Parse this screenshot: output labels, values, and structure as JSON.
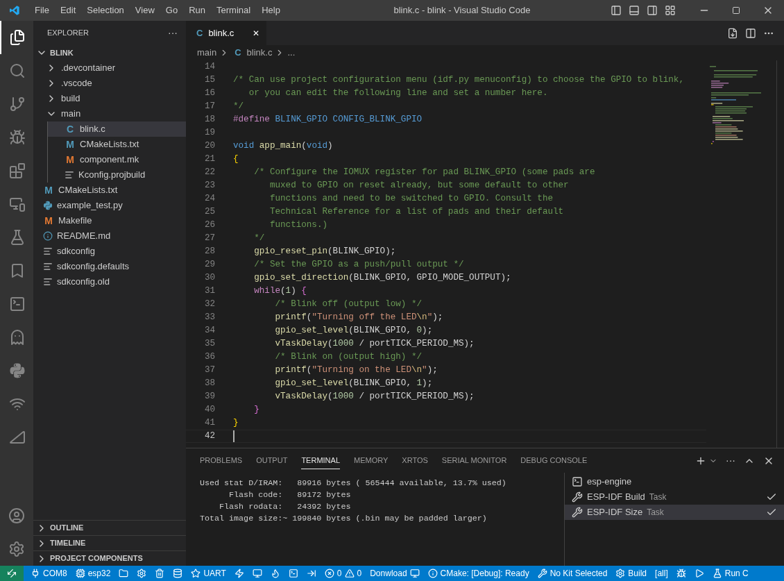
{
  "title_bar": {
    "menu": [
      "File",
      "Edit",
      "Selection",
      "View",
      "Go",
      "Run",
      "Terminal",
      "Help"
    ],
    "title": "blink.c - blink - Visual Studio Code"
  },
  "activity_bar": [
    {
      "selected": true
    },
    {
      "selected": false
    },
    {
      "selected": false
    },
    {
      "selected": false
    },
    {
      "selected": false
    },
    {
      "selected": false
    },
    {
      "selected": false
    },
    {
      "selected": false
    },
    {
      "selected": false
    },
    {
      "selected": false
    },
    {
      "selected": false
    },
    {
      "selected": false
    },
    {
      "selected": false
    }
  ],
  "sidebar": {
    "title": "EXPLORER",
    "more": "···",
    "folder": "BLINK",
    "items": [
      {
        "label": ".devcontainer",
        "kind": "folder",
        "expanded": false,
        "selected": false
      },
      {
        "label": ".vscode",
        "kind": "folder",
        "expanded": false,
        "selected": false
      },
      {
        "label": "build",
        "kind": "folder",
        "expanded": false,
        "selected": false
      },
      {
        "label": "main",
        "kind": "folder",
        "expanded": true,
        "selected": false,
        "children": [
          {
            "label": "blink.c",
            "kind": "c",
            "icon": "C",
            "selected": true
          },
          {
            "label": "CMakeLists.txt",
            "kind": "cmake",
            "icon": "M",
            "selected": false
          },
          {
            "label": "component.mk",
            "kind": "make",
            "icon": "M",
            "selected": false
          },
          {
            "label": "Kconfig.projbuild",
            "kind": "text",
            "selected": false
          }
        ]
      },
      {
        "label": "CMakeLists.txt",
        "kind": "cmake",
        "icon": "M",
        "selected": false
      },
      {
        "label": "example_test.py",
        "kind": "python",
        "selected": false
      },
      {
        "label": "Makefile",
        "kind": "make",
        "icon": "M",
        "selected": false
      },
      {
        "label": "README.md",
        "kind": "info",
        "selected": false
      },
      {
        "label": "sdkconfig",
        "kind": "text",
        "selected": false
      },
      {
        "label": "sdkconfig.defaults",
        "kind": "text",
        "selected": false
      },
      {
        "label": "sdkconfig.old",
        "kind": "text",
        "selected": false
      }
    ],
    "sections": [
      "OUTLINE",
      "TIMELINE",
      "PROJECT COMPONENTS"
    ]
  },
  "editor": {
    "tab": {
      "icon": "C",
      "label": "blink.c",
      "close": "✕"
    },
    "breadcrumbs": [
      "main",
      "blink.c",
      "..."
    ],
    "breadcrumb_icon": "C",
    "lines": [
      {
        "number": "14",
        "current": false
      },
      {
        "number": "15",
        "current": false,
        "tokens": [
          {
            "kind": "comment",
            "text": "/* Can use project configuration menu (idf.py menuconfig) to choose the GPIO to blink,"
          }
        ]
      },
      {
        "number": "16",
        "current": false,
        "tokens": [
          {
            "kind": "comment",
            "text": "   or you can edit the following line and set a number here."
          }
        ]
      },
      {
        "number": "17",
        "current": false,
        "tokens": [
          {
            "kind": "comment",
            "text": "*/"
          }
        ]
      },
      {
        "number": "18",
        "current": false,
        "tokens": [
          {
            "kind": "control",
            "text": "#define "
          },
          {
            "kind": "keyword",
            "text": "BLINK_GPIO CONFIG_BLINK_GPIO"
          }
        ]
      },
      {
        "number": "19",
        "current": false
      },
      {
        "number": "20",
        "current": false,
        "tokens": [
          {
            "kind": "keyword",
            "text": "void "
          },
          {
            "kind": "func",
            "text": "app_main"
          },
          {
            "kind": "plain",
            "text": "("
          },
          {
            "kind": "keyword",
            "text": "void"
          },
          {
            "kind": "plain",
            "text": ")"
          }
        ]
      },
      {
        "number": "21",
        "current": false,
        "tokens": [
          {
            "kind": "bracket1",
            "text": "{"
          }
        ]
      },
      {
        "number": "22",
        "current": false,
        "tokens": [
          {
            "kind": "comment",
            "text": "    /* Configure the IOMUX register for pad BLINK_GPIO (some pads are"
          }
        ]
      },
      {
        "number": "23",
        "current": false,
        "tokens": [
          {
            "kind": "comment",
            "text": "       muxed to GPIO on reset already, but some default to other"
          }
        ]
      },
      {
        "number": "24",
        "current": false,
        "tokens": [
          {
            "kind": "comment",
            "text": "       functions and need to be switched to GPIO. Consult the"
          }
        ]
      },
      {
        "number": "25",
        "current": false,
        "tokens": [
          {
            "kind": "comment",
            "text": "       Technical Reference for a list of pads and their default"
          }
        ]
      },
      {
        "number": "26",
        "current": false,
        "tokens": [
          {
            "kind": "comment",
            "text": "       functions.)"
          }
        ]
      },
      {
        "number": "27",
        "current": false,
        "tokens": [
          {
            "kind": "comment",
            "text": "    */"
          }
        ]
      },
      {
        "number": "28",
        "current": false,
        "tokens": [
          {
            "kind": "func",
            "text": "    gpio_reset_pin"
          },
          {
            "kind": "plain",
            "text": "(BLINK_GPIO);"
          }
        ]
      },
      {
        "number": "29",
        "current": false,
        "tokens": [
          {
            "kind": "comment",
            "text": "    /* Set the GPIO as a push/pull output */"
          }
        ]
      },
      {
        "number": "30",
        "current": false,
        "tokens": [
          {
            "kind": "func",
            "text": "    gpio_set_direction"
          },
          {
            "kind": "plain",
            "text": "(BLINK_GPIO, GPIO_MODE_OUTPUT);"
          }
        ]
      },
      {
        "number": "31",
        "current": false,
        "tokens": [
          {
            "kind": "control",
            "text": "    while"
          },
          {
            "kind": "plain",
            "text": "("
          },
          {
            "kind": "number",
            "text": "1"
          },
          {
            "kind": "plain",
            "text": ") "
          },
          {
            "kind": "bracket2",
            "text": "{"
          }
        ]
      },
      {
        "number": "32",
        "current": false,
        "tokens": [
          {
            "kind": "comment",
            "text": "        /* Blink off (output low) */"
          }
        ]
      },
      {
        "number": "33",
        "current": false,
        "tokens": [
          {
            "kind": "func",
            "text": "        printf"
          },
          {
            "kind": "plain",
            "text": "("
          },
          {
            "kind": "string",
            "text": "\"Turning off the LED"
          },
          {
            "kind": "escape",
            "text": "\\n"
          },
          {
            "kind": "string",
            "text": "\""
          },
          {
            "kind": "plain",
            "text": ");"
          }
        ]
      },
      {
        "number": "34",
        "current": false,
        "tokens": [
          {
            "kind": "func",
            "text": "        gpio_set_level"
          },
          {
            "kind": "plain",
            "text": "(BLINK_GPIO, "
          },
          {
            "kind": "number",
            "text": "0"
          },
          {
            "kind": "plain",
            "text": ");"
          }
        ]
      },
      {
        "number": "35",
        "current": false,
        "tokens": [
          {
            "kind": "func",
            "text": "        vTaskDelay"
          },
          {
            "kind": "plain",
            "text": "("
          },
          {
            "kind": "number",
            "text": "1000"
          },
          {
            "kind": "plain",
            "text": " / portTICK_PERIOD_MS);"
          }
        ]
      },
      {
        "number": "36",
        "current": false,
        "tokens": [
          {
            "kind": "comment",
            "text": "        /* Blink on (output high) */"
          }
        ]
      },
      {
        "number": "37",
        "current": false,
        "tokens": [
          {
            "kind": "func",
            "text": "        printf"
          },
          {
            "kind": "plain",
            "text": "("
          },
          {
            "kind": "string",
            "text": "\"Turning on the LED"
          },
          {
            "kind": "escape",
            "text": "\\n"
          },
          {
            "kind": "string",
            "text": "\""
          },
          {
            "kind": "plain",
            "text": ");"
          }
        ]
      },
      {
        "number": "38",
        "current": false,
        "tokens": [
          {
            "kind": "func",
            "text": "        gpio_set_level"
          },
          {
            "kind": "plain",
            "text": "(BLINK_GPIO, "
          },
          {
            "kind": "number",
            "text": "1"
          },
          {
            "kind": "plain",
            "text": ");"
          }
        ]
      },
      {
        "number": "39",
        "current": false,
        "tokens": [
          {
            "kind": "func",
            "text": "        vTaskDelay"
          },
          {
            "kind": "plain",
            "text": "("
          },
          {
            "kind": "number",
            "text": "1000"
          },
          {
            "kind": "plain",
            "text": " / portTICK_PERIOD_MS);"
          }
        ]
      },
      {
        "number": "40",
        "current": false,
        "tokens": [
          {
            "kind": "bracket2",
            "text": "    }"
          }
        ]
      },
      {
        "number": "41",
        "current": false,
        "tokens": [
          {
            "kind": "bracket1",
            "text": "}"
          }
        ]
      },
      {
        "number": "42",
        "current": true
      }
    ]
  },
  "panel": {
    "tabs": [
      {
        "label": "PROBLEMS",
        "selected": false
      },
      {
        "label": "OUTPUT",
        "selected": false
      },
      {
        "label": "TERMINAL",
        "selected": true
      },
      {
        "label": "MEMORY",
        "selected": false
      },
      {
        "label": "XRTOS",
        "selected": false
      },
      {
        "label": "SERIAL MONITOR",
        "selected": false
      },
      {
        "label": "DEBUG CONSOLE",
        "selected": false
      }
    ],
    "more": "···",
    "terminal_lines": [
      "Used stat D/IRAM:   89916 bytes ( 565444 available, 13.7% used)",
      "      Flash code:   89172 bytes",
      "    Flash rodata:   24392 bytes",
      "Total image size:~ 199840 bytes (.bin may be padded larger)"
    ],
    "terminals": [
      {
        "kind": "shell",
        "name": "esp-engine",
        "selected": false,
        "done": false
      },
      {
        "kind": "task",
        "name": "ESP-IDF Build",
        "tag": "Task",
        "selected": false,
        "done": true
      },
      {
        "kind": "task",
        "name": "ESP-IDF Size",
        "tag": "Task",
        "selected": true,
        "done": true
      }
    ]
  },
  "status_bar": [
    {
      "kind": "remote"
    },
    {
      "kind": "plug",
      "text": "COM8"
    },
    {
      "kind": "chip",
      "text": "esp32"
    },
    {
      "kind": "folder"
    },
    {
      "kind": "gear"
    },
    {
      "kind": "trash"
    },
    {
      "kind": "database"
    },
    {
      "kind": "star",
      "text": "UART"
    },
    {
      "kind": "flash"
    },
    {
      "kind": "monitor"
    },
    {
      "kind": "flame"
    },
    {
      "kind": "terminal"
    },
    {
      "kind": "enter"
    },
    {
      "kind": "problems",
      "errors": "0",
      "warnings": "0"
    },
    {
      "kind": "download",
      "text": "Donwload"
    },
    {
      "kind": "info",
      "text": "CMake: [Debug]: Ready"
    },
    {
      "kind": "tools",
      "text": "No Kit Selected"
    },
    {
      "kind": "gear",
      "text": "Build"
    },
    {
      "kind": "text",
      "text": "[all]"
    },
    {
      "kind": "bug"
    },
    {
      "kind": "play"
    },
    {
      "kind": "flask",
      "text": "Run C"
    }
  ]
}
